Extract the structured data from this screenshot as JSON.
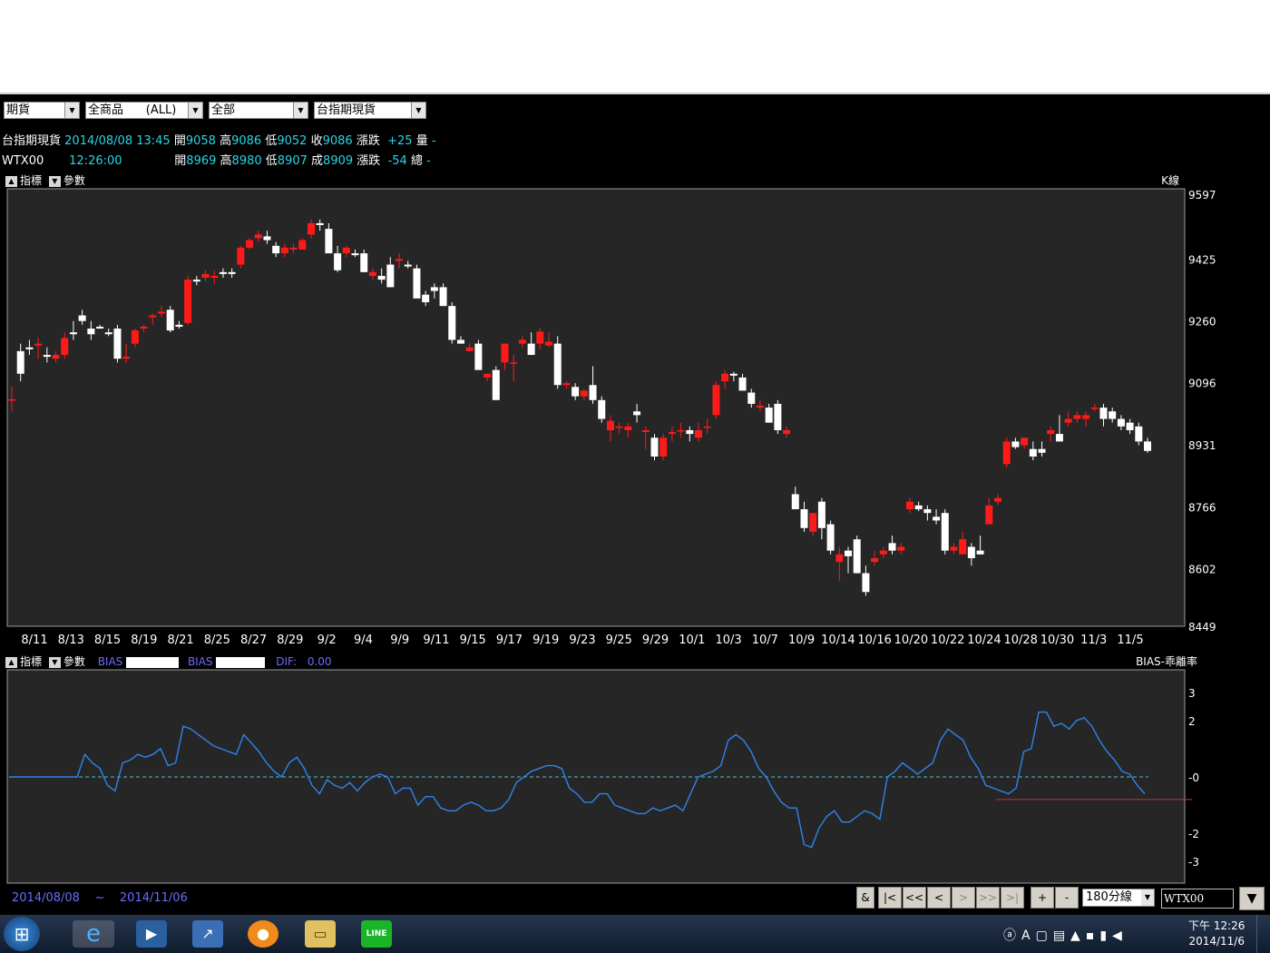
{
  "toolbar": {
    "combos": [
      {
        "value": "期貨"
      },
      {
        "value": "全商品      (ALL)"
      },
      {
        "value": "全部"
      },
      {
        "value": "台指期現貨"
      }
    ]
  },
  "info": {
    "row1": {
      "name": "台指期現貨",
      "datetime": "2014/08/08 13:45",
      "l_open": "開",
      "open": "9058",
      "l_high": "高",
      "high": "9086",
      "l_low": "低",
      "low": "9052",
      "l_close": "收",
      "close": "9086",
      "l_chg": "漲跌",
      "chg": "+25",
      "l_vol": "量",
      "vol": "-"
    },
    "row2": {
      "name": "WTX00",
      "datetime": "12:26:00",
      "l_open": "開",
      "open": "8969",
      "l_high": "高",
      "high": "8980",
      "l_low": "低",
      "low": "8907",
      "l_close": "成",
      "close": "8909",
      "l_chg": "漲跌",
      "chg": "-54",
      "l_vol": "總",
      "vol": "-"
    }
  },
  "top_panel": {
    "indicator_label": "指標",
    "param_label": "參數",
    "chart_label": "K線"
  },
  "bottom_panel": {
    "indicator_label": "指標",
    "param_label": "參數",
    "bias1_label": "BIAS",
    "bias2_label": "BIAS",
    "dif_label": "DIF:",
    "dif_value": "0.00",
    "chart_label": "BIAS-乖離率"
  },
  "footer": {
    "date_from": "2014/08/08",
    "tilde": "~",
    "date_to": "2014/11/06"
  },
  "nav_buttons": [
    "&",
    "|<",
    "<<",
    "<",
    ">",
    ">>",
    ">|",
    "+",
    "-"
  ],
  "period_select": "180分線",
  "symbol_input": "WTX00",
  "taskbar": {
    "time": "下午 12:26",
    "date": "2014/11/6"
  },
  "colors": {
    "up": "#ff1a1a",
    "down": "#ffffff",
    "panel_bg": "#262626",
    "bias_line": "#2f84ee",
    "zero_line": "#3ec7d0",
    "ref_line": "#c83030",
    "axis_text": "#ffffff",
    "label_blue": "#6b6bff"
  },
  "chart_data": [
    {
      "type": "candlestick",
      "title": "K線",
      "y_ticks": [
        9597,
        9425,
        9260,
        9096,
        8931,
        8766,
        8602,
        8449
      ],
      "ylim": [
        8449,
        9597
      ],
      "x_ticks": [
        "8/11",
        "8/13",
        "8/15",
        "8/19",
        "8/21",
        "8/25",
        "8/27",
        "8/29",
        "9/2",
        "9/4",
        "9/9",
        "9/11",
        "9/15",
        "9/17",
        "9/19",
        "9/23",
        "9/25",
        "9/29",
        "10/1",
        "10/3",
        "10/7",
        "10/9",
        "10/14",
        "10/16",
        "10/20",
        "10/22",
        "10/24",
        "10/28",
        "10/30",
        "11/3",
        "11/5"
      ],
      "candles": [
        [
          9050,
          9086,
          9020,
          9052
        ],
        [
          9180,
          9200,
          9100,
          9120
        ],
        [
          9190,
          9210,
          9170,
          9185
        ],
        [
          9195,
          9215,
          9160,
          9200
        ],
        [
          9170,
          9190,
          9150,
          9165
        ],
        [
          9160,
          9180,
          9150,
          9170
        ],
        [
          9170,
          9230,
          9160,
          9215
        ],
        [
          9230,
          9260,
          9210,
          9225
        ],
        [
          9275,
          9290,
          9250,
          9260
        ],
        [
          9240,
          9260,
          9210,
          9225
        ],
        [
          9245,
          9250,
          9240,
          9240
        ],
        [
          9230,
          9240,
          9220,
          9225
        ],
        [
          9240,
          9250,
          9150,
          9160
        ],
        [
          9160,
          9200,
          9150,
          9165
        ],
        [
          9200,
          9240,
          9190,
          9235
        ],
        [
          9240,
          9250,
          9230,
          9245
        ],
        [
          9270,
          9280,
          9250,
          9275
        ],
        [
          9280,
          9300,
          9270,
          9285
        ],
        [
          9290,
          9300,
          9230,
          9235
        ],
        [
          9250,
          9260,
          9240,
          9245
        ],
        [
          9255,
          9380,
          9250,
          9370
        ],
        [
          9370,
          9380,
          9355,
          9365
        ],
        [
          9375,
          9395,
          9365,
          9385
        ],
        [
          9375,
          9395,
          9360,
          9380
        ],
        [
          9390,
          9400,
          9375,
          9385
        ],
        [
          9390,
          9400,
          9375,
          9385
        ],
        [
          9410,
          9460,
          9400,
          9455
        ],
        [
          9455,
          9480,
          9450,
          9475
        ],
        [
          9480,
          9500,
          9470,
          9490
        ],
        [
          9485,
          9500,
          9465,
          9475
        ],
        [
          9460,
          9470,
          9430,
          9440
        ],
        [
          9440,
          9465,
          9430,
          9455
        ],
        [
          9450,
          9465,
          9440,
          9455
        ],
        [
          9450,
          9480,
          9450,
          9475
        ],
        [
          9490,
          9530,
          9480,
          9520
        ],
        [
          9520,
          9530,
          9500,
          9515
        ],
        [
          9505,
          9520,
          9450,
          9440
        ],
        [
          9440,
          9460,
          9390,
          9395
        ],
        [
          9440,
          9460,
          9430,
          9455
        ],
        [
          9440,
          9450,
          9430,
          9435
        ],
        [
          9440,
          9450,
          9390,
          9390
        ],
        [
          9380,
          9400,
          9370,
          9390
        ],
        [
          9380,
          9400,
          9360,
          9370
        ],
        [
          9410,
          9430,
          9350,
          9350
        ],
        [
          9420,
          9440,
          9400,
          9425
        ],
        [
          9410,
          9420,
          9400,
          9405
        ],
        [
          9400,
          9410,
          9340,
          9320
        ],
        [
          9330,
          9340,
          9300,
          9310
        ],
        [
          9350,
          9360,
          9320,
          9340
        ],
        [
          9350,
          9360,
          9300,
          9300
        ],
        [
          9300,
          9310,
          9200,
          9210
        ],
        [
          9210,
          9220,
          9200,
          9200
        ],
        [
          9180,
          9200,
          9180,
          9190
        ],
        [
          9200,
          9210,
          9140,
          9130
        ],
        [
          9110,
          9120,
          9100,
          9120
        ],
        [
          9130,
          9140,
          9060,
          9050
        ],
        [
          9150,
          9200,
          9130,
          9200
        ],
        [
          9150,
          9170,
          9100,
          9150
        ],
        [
          9200,
          9220,
          9190,
          9210
        ],
        [
          9200,
          9230,
          9170,
          9170
        ],
        [
          9200,
          9240,
          9185,
          9232
        ],
        [
          9195,
          9230,
          9190,
          9205
        ],
        [
          9200,
          9220,
          9080,
          9090
        ],
        [
          9090,
          9100,
          9080,
          9095
        ],
        [
          9085,
          9095,
          9050,
          9060
        ],
        [
          9060,
          9080,
          9050,
          9075
        ],
        [
          9090,
          9140,
          9040,
          9050
        ],
        [
          9050,
          9060,
          8990,
          9000
        ],
        [
          8970,
          9010,
          8940,
          8995
        ],
        [
          8980,
          8990,
          8960,
          8980
        ],
        [
          8970,
          8990,
          8950,
          8980
        ],
        [
          9020,
          9040,
          8990,
          9010
        ],
        [
          8965,
          8980,
          8920,
          8970
        ],
        [
          8950,
          8960,
          8890,
          8900
        ],
        [
          8900,
          8960,
          8890,
          8950
        ],
        [
          8960,
          8980,
          8940,
          8965
        ],
        [
          8970,
          8990,
          8950,
          8970
        ],
        [
          8970,
          8980,
          8940,
          8960
        ],
        [
          8950,
          8990,
          8940,
          8970
        ],
        [
          8980,
          9000,
          8960,
          8980
        ],
        [
          9010,
          9100,
          9000,
          9090
        ],
        [
          9100,
          9130,
          9080,
          9120
        ],
        [
          9120,
          9125,
          9100,
          9115
        ],
        [
          9110,
          9120,
          9080,
          9075
        ],
        [
          9070,
          9080,
          9030,
          9040
        ],
        [
          9030,
          9050,
          9020,
          9035
        ],
        [
          9030,
          9040,
          8990,
          8990
        ],
        [
          9040,
          9050,
          8960,
          8970
        ],
        [
          8960,
          8980,
          8950,
          8970
        ],
        [
          8800,
          8820,
          8770,
          8760
        ],
        [
          8760,
          8780,
          8700,
          8710
        ],
        [
          8700,
          8740,
          8690,
          8750
        ],
        [
          8780,
          8790,
          8680,
          8710
        ],
        [
          8720,
          8730,
          8640,
          8650
        ],
        [
          8620,
          8660,
          8570,
          8640
        ],
        [
          8650,
          8660,
          8590,
          8635
        ],
        [
          8680,
          8690,
          8590,
          8590
        ],
        [
          8590,
          8610,
          8530,
          8540
        ],
        [
          8620,
          8650,
          8610,
          8630
        ],
        [
          8640,
          8660,
          8630,
          8650
        ],
        [
          8670,
          8690,
          8640,
          8650
        ],
        [
          8650,
          8670,
          8640,
          8660
        ],
        [
          8760,
          8790,
          8750,
          8780
        ],
        [
          8770,
          8780,
          8755,
          8760
        ],
        [
          8760,
          8770,
          8730,
          8750
        ],
        [
          8740,
          8760,
          8720,
          8730
        ],
        [
          8750,
          8760,
          8640,
          8650
        ],
        [
          8650,
          8670,
          8640,
          8660
        ],
        [
          8640,
          8700,
          8640,
          8680
        ],
        [
          8660,
          8670,
          8610,
          8630
        ],
        [
          8650,
          8690,
          8640,
          8640
        ],
        [
          8720,
          8790,
          8720,
          8770
        ],
        [
          8780,
          8800,
          8770,
          8790
        ],
        [
          8880,
          8950,
          8870,
          8940
        ],
        [
          8940,
          8950,
          8920,
          8925
        ],
        [
          8930,
          8950,
          8920,
          8950
        ],
        [
          8920,
          8940,
          8890,
          8900
        ],
        [
          8920,
          8940,
          8900,
          8910
        ],
        [
          8960,
          8980,
          8940,
          8970
        ],
        [
          8960,
          9010,
          8940,
          8940
        ],
        [
          8990,
          9020,
          8980,
          9000
        ],
        [
          9000,
          9020,
          8990,
          9010
        ],
        [
          9000,
          9020,
          8980,
          9010
        ],
        [
          9030,
          9040,
          9020,
          9030
        ],
        [
          9030,
          9040,
          8980,
          9000
        ],
        [
          9020,
          9030,
          8990,
          9000
        ],
        [
          9000,
          9010,
          8970,
          8980
        ],
        [
          8990,
          9000,
          8960,
          8970
        ],
        [
          8980,
          8990,
          8930,
          8940
        ],
        [
          8940,
          8950,
          8910,
          8915
        ]
      ]
    },
    {
      "type": "line",
      "title": "BIAS-乖離率",
      "y_ticks": [
        3,
        2,
        0,
        -2,
        -3
      ],
      "ylim": [
        -3.8,
        3.8
      ],
      "series": [
        {
          "values": [
            0.0,
            0.0,
            0.0,
            0.0,
            0.0,
            0.0,
            0.0,
            0.0,
            0.0,
            0.0,
            0.8,
            0.5,
            0.3,
            -0.3,
            -0.5,
            0.5,
            0.6,
            0.8,
            0.7,
            0.8,
            1.0,
            0.4,
            0.5,
            1.8,
            1.7,
            1.5,
            1.3,
            1.1,
            1.0,
            0.9,
            0.8,
            1.5,
            1.2,
            0.9,
            0.5,
            0.2,
            0.0,
            0.5,
            0.7,
            0.3,
            -0.3,
            -0.6,
            -0.1,
            -0.3,
            -0.4,
            -0.2,
            -0.5,
            -0.2,
            0.0,
            0.1,
            0.0,
            -0.6,
            -0.4,
            -0.4,
            -1.0,
            -0.7,
            -0.7,
            -1.1,
            -1.2,
            -1.2,
            -1.0,
            -0.9,
            -1.0,
            -1.2,
            -1.2,
            -1.1,
            -0.8,
            -0.2,
            0.0,
            0.2,
            0.3,
            0.4,
            0.4,
            0.3,
            -0.4,
            -0.6,
            -0.9,
            -0.9,
            -0.6,
            -0.6,
            -1.0,
            -1.1,
            -1.2,
            -1.3,
            -1.3,
            -1.1,
            -1.2,
            -1.1,
            -1.0,
            -1.2,
            -0.6,
            0.0,
            0.1,
            0.2,
            0.4,
            1.3,
            1.5,
            1.3,
            0.9,
            0.3,
            0.0,
            -0.5,
            -0.9,
            -1.1,
            -1.1,
            -2.4,
            -2.5,
            -1.8,
            -1.4,
            -1.2,
            -1.6,
            -1.6,
            -1.4,
            -1.2,
            -1.3,
            -1.5,
            0.0,
            0.2,
            0.5,
            0.3,
            0.1,
            0.3,
            0.5,
            1.3,
            1.7,
            1.5,
            1.3,
            0.7,
            0.3,
            -0.3,
            -0.4,
            -0.5,
            -0.6,
            -0.4,
            0.9,
            1.0,
            2.3,
            2.3,
            1.8,
            1.9,
            1.7,
            2.0,
            2.1,
            1.8,
            1.3,
            0.9,
            0.6,
            0.2,
            0.1,
            -0.3,
            -0.6
          ]
        },
        {
          "values": [
            0,
            0
          ]
        }
      ]
    }
  ]
}
